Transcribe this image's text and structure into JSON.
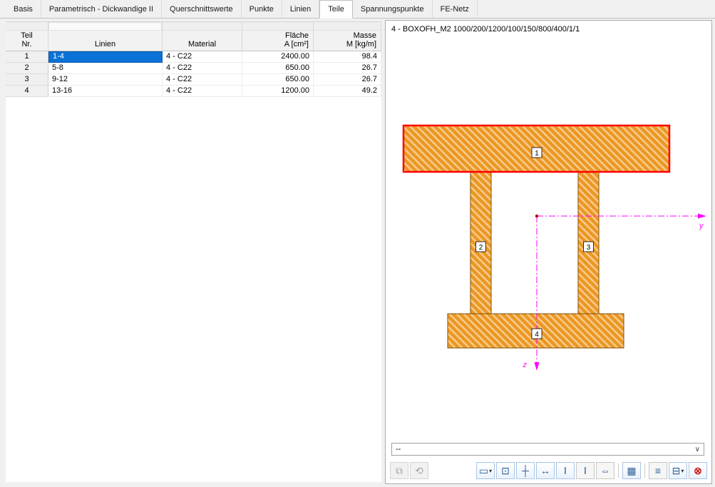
{
  "tabs": [
    {
      "label": "Basis"
    },
    {
      "label": "Parametrisch - Dickwandige II"
    },
    {
      "label": "Querschnittswerte"
    },
    {
      "label": "Punkte"
    },
    {
      "label": "Linien"
    },
    {
      "label": "Teile"
    },
    {
      "label": "Spannungspunkte"
    },
    {
      "label": "FE-Netz"
    }
  ],
  "table": {
    "header": [
      {
        "line1": "Teil",
        "line2": "Nr."
      },
      {
        "line1": "",
        "line2": "Linien"
      },
      {
        "line1": "",
        "line2": "Material"
      },
      {
        "line1": "Fläche",
        "line2": "A [cm²]"
      },
      {
        "line1": "Masse",
        "line2": "M [kg/m]"
      }
    ],
    "rows": [
      {
        "nr": "1",
        "linien": "1-4",
        "material": "4 - C22",
        "flaeche": "2400.00",
        "masse": "98.4"
      },
      {
        "nr": "2",
        "linien": "5-8",
        "material": "4 - C22",
        "flaeche": "650.00",
        "masse": "26.7"
      },
      {
        "nr": "3",
        "linien": "9-12",
        "material": "4 - C22",
        "flaeche": "650.00",
        "masse": "26.7"
      },
      {
        "nr": "4",
        "linien": "13-16",
        "material": "4 - C22",
        "flaeche": "1200.00",
        "masse": "49.2"
      }
    ]
  },
  "preview": {
    "title": "4 - BOXOFH_M2 1000/200/1200/100/150/800/400/1/1",
    "axes": {
      "y": "y",
      "z": "z"
    },
    "parts": [
      {
        "label": "1"
      },
      {
        "label": "2"
      },
      {
        "label": "3"
      },
      {
        "label": "4"
      }
    ],
    "combo_value": "--",
    "colors": {
      "section_fill": "#EC9723",
      "hatch_line": "#F8CE93",
      "selected_outline": "#FF0000",
      "outline": "#7F4F00",
      "axis": "#FF00FF",
      "selection_blue": "#0B72D7"
    }
  },
  "toolbar": {
    "dropdown_icon": "▾",
    "chevron": "∨",
    "left": [
      {
        "name": "copy-picture",
        "icon": "⧉"
      },
      {
        "name": "insert-joint",
        "icon": "⟲"
      }
    ],
    "right": [
      {
        "name": "display-properties",
        "icon": "▭"
      },
      {
        "name": "save-picture",
        "icon": "⊡"
      },
      {
        "name": "show-axes",
        "icon": "┼"
      },
      {
        "name": "show-dimensions",
        "icon": "↔"
      },
      {
        "name": "show-section-filled",
        "icon": "Ⅰ"
      },
      {
        "name": "show-section-outline",
        "icon": "Ⅰ"
      },
      {
        "name": "show-weld-dimensions",
        "icon": "⇔"
      },
      {
        "name": "show-table",
        "icon": "▦"
      },
      {
        "name": "show-value-list",
        "icon": "≡"
      },
      {
        "name": "print",
        "icon": "⊟"
      },
      {
        "name": "zoom-all",
        "icon": "⊗"
      }
    ]
  }
}
